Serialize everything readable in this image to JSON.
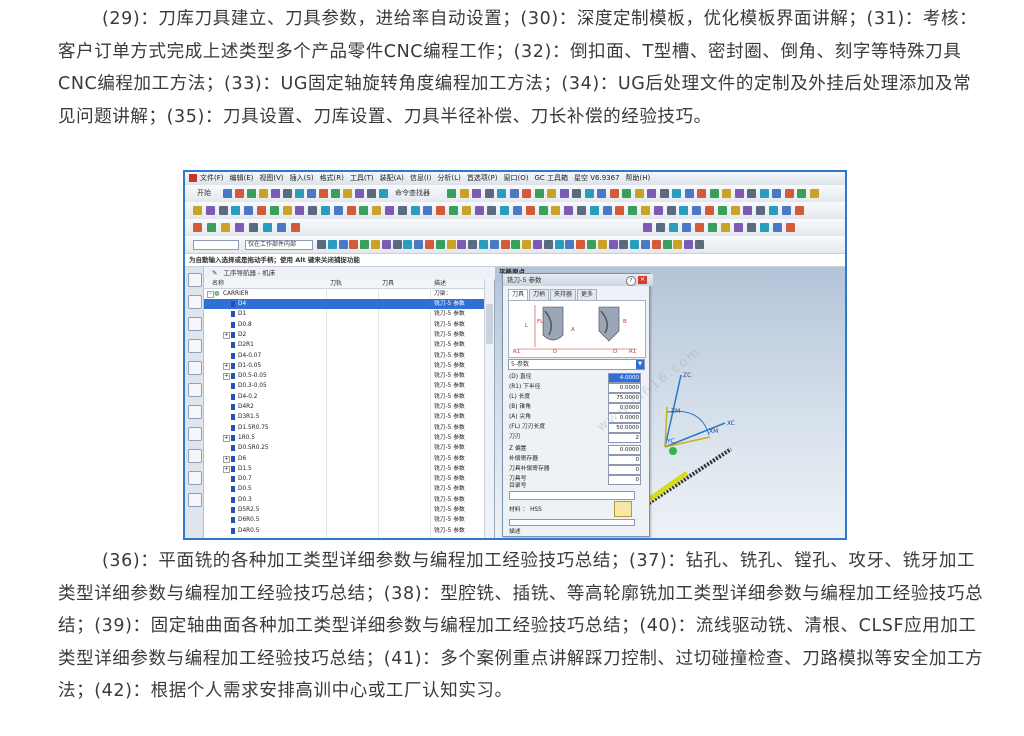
{
  "paragraph_1": "(29)：刀库刀具建立、刀具参数，进给率自动设置；(30)：深度定制模板，优化模板界面讲解；(31)：考核：客户订单方式完成上述类型多个产品零件CNC编程工作；(32)：倒扣面、T型槽、密封圈、倒角、刻字等特殊刀具CNC编程加工方法；(33)：UG固定轴旋转角度编程加工方法；(34)：UG后处理文件的定制及外挂后处理添加及常见问题讲解；(35)：刀具设置、刀库设置、刀具半径补偿、刀长补偿的经验技巧。",
  "paragraph_2": "(36)：平面铣的各种加工类型详细参数与编程加工经验技巧总结；(37)：钻孔、铣孔、镗孔、攻牙、铣牙加工类型详细参数与编程加工经验技巧总结；(38)：型腔铣、插铣、等高轮廓铣加工类型详细参数与编程加工经验技巧总结；(39)：固定轴曲面各种加工类型详细参数与编程加工经验技巧总结；(40)：流线驱动铣、清根、CLSF应用加工类型详细参数与编程加工经验技巧总结；(41)：多个案例重点讲解踩刀控制、过切碰撞检查、刀路模拟等安全加工方法；(42)：根据个人需求安排高训中心或工厂认知实习。",
  "screenshot": {
    "menu": [
      "文件(F)",
      "编辑(E)",
      "视图(V)",
      "插入(S)",
      "格式(R)",
      "工具(T)",
      "装配(A)",
      "信息(I)",
      "分析(L)",
      "首选项(P)",
      "窗口(O)",
      "GC 工具箱",
      "星空 V6.9367",
      "帮助(H)"
    ],
    "toolbar_start": "开始",
    "toolbar_cmd": "命令查找器",
    "filter_value": "仅在工作部件内部",
    "status_text": "为自動输入选择或是拖动手柄；使用 Alt 键来关闭捕捉功能",
    "viewport_label": "平移原点",
    "navigator": {
      "title": "工序导航器 - 机床",
      "columns": [
        "名称",
        "刀轨",
        "刀具",
        "描述"
      ],
      "root": "CARRIER",
      "root_desc": "刀架：",
      "rows": [
        {
          "name": "D4",
          "desc": "铣刀-5 参数",
          "expander": false,
          "selected": true
        },
        {
          "name": "D1",
          "desc": "铣刀-5 参数",
          "expander": false
        },
        {
          "name": "D0.8",
          "desc": "铣刀-5 参数",
          "expander": false
        },
        {
          "name": "D2",
          "desc": "铣刀-5 参数",
          "expander": true
        },
        {
          "name": "D2R1",
          "desc": "铣刀-5 参数",
          "expander": false
        },
        {
          "name": "D4-0.07",
          "desc": "铣刀-5 参数",
          "expander": false
        },
        {
          "name": "D1-0.05",
          "desc": "铣刀-5 参数",
          "expander": true
        },
        {
          "name": "D0.5-0.05",
          "desc": "铣刀-5 参数",
          "expander": true
        },
        {
          "name": "D0.3-0.05",
          "desc": "铣刀-5 参数",
          "expander": false
        },
        {
          "name": "D4-0.2",
          "desc": "铣刀-5 参数",
          "expander": false
        },
        {
          "name": "D4R2",
          "desc": "铣刀-5 参数",
          "expander": false
        },
        {
          "name": "D3R1.5",
          "desc": "铣刀-5 参数",
          "expander": false
        },
        {
          "name": "D1.5R0.75",
          "desc": "铣刀-5 参数",
          "expander": false
        },
        {
          "name": "1R0.5",
          "desc": "铣刀-5 参数",
          "expander": true
        },
        {
          "name": "D0.5R0.25",
          "desc": "铣刀-5 参数",
          "expander": false
        },
        {
          "name": "D6",
          "desc": "铣刀-5 参数",
          "expander": true
        },
        {
          "name": "D1.5",
          "desc": "铣刀-5 参数",
          "expander": true
        },
        {
          "name": "D0.7",
          "desc": "铣刀-5 参数",
          "expander": false
        },
        {
          "name": "D0.5",
          "desc": "铣刀-5 参数",
          "expander": false
        },
        {
          "name": "D0.3",
          "desc": "铣刀-5 参数",
          "expander": false
        },
        {
          "name": "D5R2.5",
          "desc": "铣刀-5 参数",
          "expander": false
        },
        {
          "name": "D6R0.5",
          "desc": "铣刀-5 参数",
          "expander": false
        },
        {
          "name": "D4R0.5",
          "desc": "铣刀-5 参数",
          "expander": false
        }
      ]
    },
    "dialog": {
      "title": "铣刀-5 参数",
      "tabs": [
        "刀具",
        "刀柄",
        "夹持器",
        "更多"
      ],
      "type_select": "5-参数",
      "params": [
        {
          "label": "(D) 直径",
          "value": "4.0000",
          "highlight": true
        },
        {
          "label": "(R1) 下半径",
          "value": "0.0000"
        },
        {
          "label": "(L) 长度",
          "value": "75.0000"
        },
        {
          "label": "(B) 锥角",
          "value": "0.0000"
        },
        {
          "label": "(A) 尖角",
          "value": "0.0000"
        },
        {
          "label": "(FL) 刀刃长度",
          "value": "50.0000"
        },
        {
          "label": "刀刃",
          "value": "2"
        },
        {
          "label": "Z 偏置",
          "value": "0.0000"
        },
        {
          "label": "补偿寄存器",
          "value": "0"
        },
        {
          "label": "刀具补偿寄存器",
          "value": "0"
        },
        {
          "label": "刀具号",
          "value": "0"
        }
      ],
      "catalog_label": "目录号",
      "material_label": "材料 ： HSS",
      "description_label": "描述"
    },
    "axes": [
      "ZC",
      "ZM",
      "YC",
      "XM",
      "XC"
    ],
    "watermark": "www.m616.com"
  }
}
